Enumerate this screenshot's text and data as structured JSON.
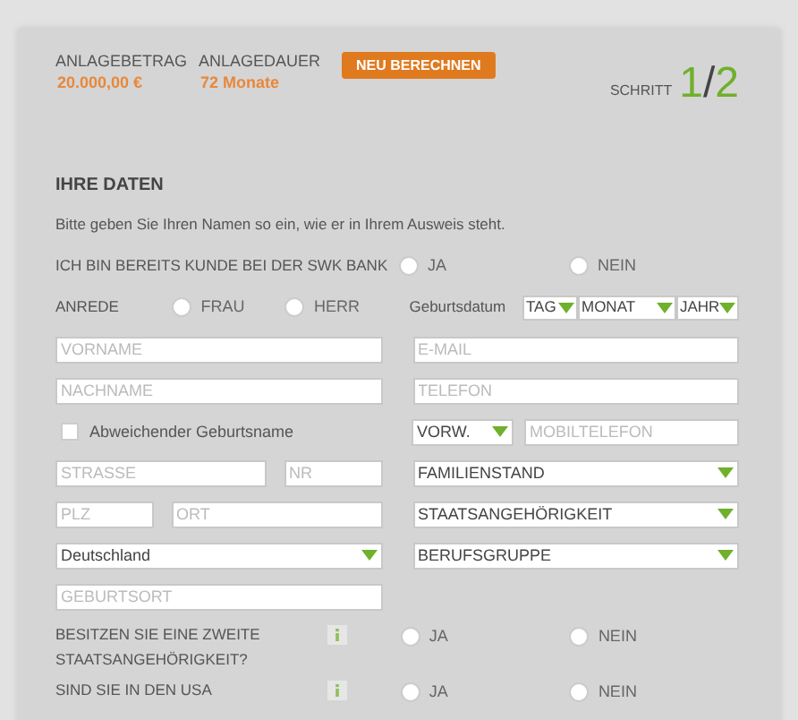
{
  "header": {
    "amount_label": "ANLAGEBETRAG",
    "amount": "20.000,00 €",
    "duration_label": "ANLAGEDAUER",
    "duration": "72 Monate",
    "recalc_button": "NEU BERECHNEN",
    "step_label": "SCHRITT",
    "step_current": "1",
    "step_separator": "/",
    "step_total": "2"
  },
  "section_title": "IHRE DATEN",
  "intro": "Bitte geben Sie Ihren Namen so ein, wie er in Ihrem Ausweis steht.",
  "customer": {
    "label": "ICH BIN BEREITS KUNDE BEI DER SWK BANK",
    "options": [
      {
        "label": "JA",
        "selected": false
      },
      {
        "label": "NEIN",
        "selected": false
      }
    ]
  },
  "salutation": {
    "label": "ANREDE",
    "options": [
      {
        "label": "FRAU",
        "selected": false
      },
      {
        "label": "HERR",
        "selected": false
      }
    ]
  },
  "birthdate": {
    "label": "Geburtsdatum",
    "selects": [
      {
        "value": "TAG"
      },
      {
        "value": "MONAT"
      },
      {
        "value": "JAHR"
      }
    ]
  },
  "form_rows": [
    {
      "left": [
        {
          "kind": "input",
          "placeholder": "VORNAME"
        }
      ],
      "right": [
        {
          "kind": "input",
          "placeholder": "E-MAIL"
        }
      ]
    },
    {
      "left": [
        {
          "kind": "input",
          "placeholder": "NACHNAME"
        }
      ],
      "right": [
        {
          "kind": "input",
          "placeholder": "TELEFON"
        }
      ]
    },
    {
      "left": [
        {
          "kind": "checkbox",
          "label": "Abweichender Geburtsname",
          "checked": false
        }
      ],
      "right": [
        {
          "kind": "select",
          "value": "VORW."
        },
        {
          "kind": "input",
          "placeholder": "MOBILTELEFON"
        }
      ]
    },
    {
      "left": [
        {
          "kind": "input",
          "placeholder": "STRASSE"
        },
        {
          "kind": "input",
          "placeholder": "NR"
        }
      ],
      "right": [
        {
          "kind": "select",
          "value": "FAMILIENSTAND"
        }
      ]
    },
    {
      "left": [
        {
          "kind": "input",
          "placeholder": "PLZ"
        },
        {
          "kind": "input",
          "placeholder": "ORT"
        }
      ],
      "right": [
        {
          "kind": "select",
          "value": "STAATSANGEHÖRIGKEIT"
        }
      ]
    },
    {
      "left": [
        {
          "kind": "select",
          "value": "Deutschland"
        }
      ],
      "right": [
        {
          "kind": "select",
          "value": "BERUFSGRUPPE"
        }
      ]
    },
    {
      "left": [
        {
          "kind": "input",
          "placeholder": "GEBURTSORT"
        }
      ],
      "right": []
    }
  ],
  "questions": [
    {
      "label": "BESITZEN SIE EINE ZWEITE STAATSANGEHÖRIGKEIT?",
      "options": [
        {
          "label": "JA",
          "selected": false
        },
        {
          "label": "NEIN",
          "selected": false
        }
      ]
    },
    {
      "label": "SIND SIE IN DEN USA",
      "options": [
        {
          "label": "JA",
          "selected": false
        },
        {
          "label": "NEIN",
          "selected": false
        }
      ]
    }
  ]
}
